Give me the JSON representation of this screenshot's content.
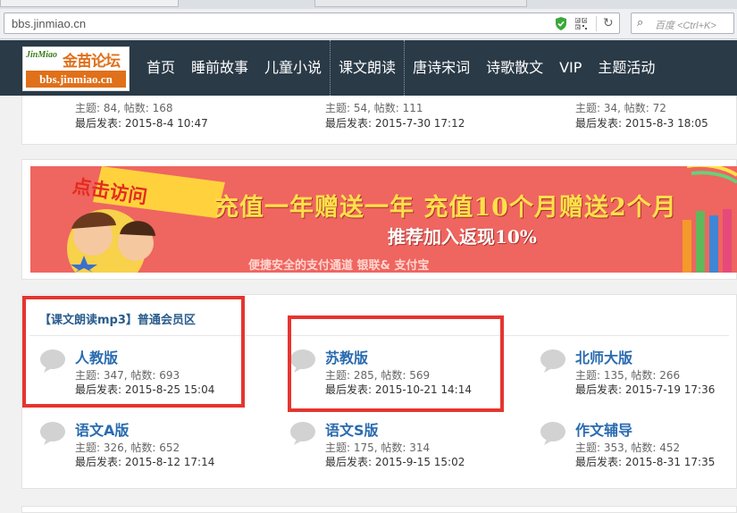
{
  "browser": {
    "url": "bbs.jinmiao.cn",
    "search_placeholder": "百度 <Ctrl+K>"
  },
  "logo": {
    "brand_latin": "JinMiao",
    "brand_cn": "金苗论坛",
    "brand_url": "bbs.jinmiao.cn"
  },
  "nav": {
    "items": [
      "首页",
      "睡前故事",
      "儿童小说",
      "课文朗读",
      "唐诗宋词",
      "诗歌散文",
      "VIP",
      "主题活动"
    ],
    "active_index": 3
  },
  "top_forums": [
    {
      "stats": "主题: 84, 帖数: 168",
      "last_post": "最后发表: 2015-8-4 10:47"
    },
    {
      "stats": "主题: 54, 帖数: 111",
      "last_post": "最后发表: 2015-7-30 17:12"
    },
    {
      "stats": "主题: 34, 帖数: 72",
      "last_post": "最后发表: 2015-8-3 18:05"
    }
  ],
  "banner": {
    "ribbon": "点击访问",
    "line1": "充值一年赠送一年 充值10个月赠送2个月",
    "line2": "推荐加入返现10%",
    "line3": "便捷安全的支付通道 银联& 支付宝"
  },
  "section": {
    "title": "【课文朗读mp3】普通会员区"
  },
  "forums": [
    {
      "name": "人教版",
      "stats": "主题: 347, 帖数: 693",
      "last_post": "最后发表: 2015-8-25 15:04"
    },
    {
      "name": "苏教版",
      "stats": "主题: 285, 帖数: 569",
      "last_post": "最后发表: 2015-10-21 14:14"
    },
    {
      "name": "北师大版",
      "stats": "主题: 135, 帖数: 266",
      "last_post": "最后发表: 2015-7-19 17:36"
    },
    {
      "name": "语文A版",
      "stats": "主题: 326, 帖数: 652",
      "last_post": "最后发表: 2015-8-12 17:14"
    },
    {
      "name": "语文S版",
      "stats": "主题: 175, 帖数: 314",
      "last_post": "最后发表: 2015-9-15 15:02"
    },
    {
      "name": "作文辅导",
      "stats": "主题: 353, 帖数: 452",
      "last_post": "最后发表: 2015-8-31 17:35"
    }
  ],
  "colors": {
    "header_bg": "#2a3a47",
    "link": "#2a6bb0",
    "highlight_box": "#e6352f",
    "banner_bg": "#ef6560"
  }
}
